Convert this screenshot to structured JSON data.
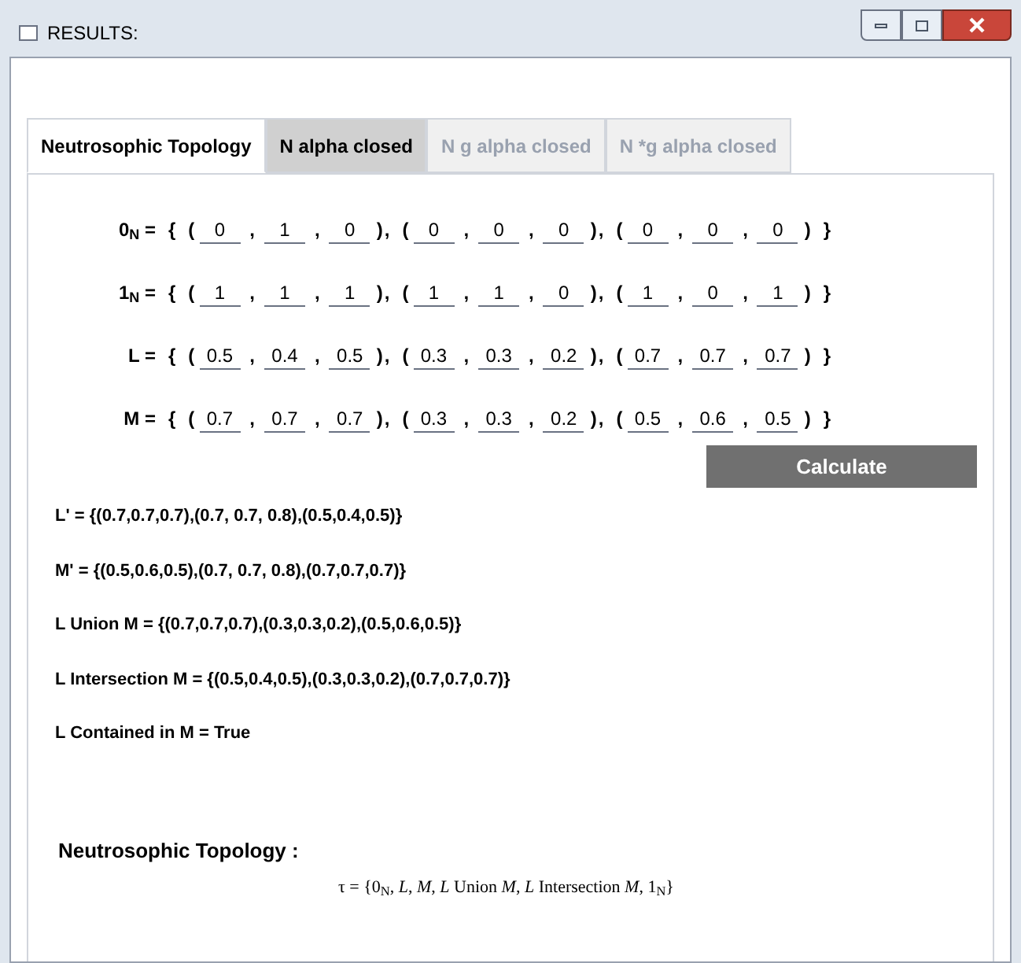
{
  "window": {
    "title": "RESULTS:"
  },
  "tabs": [
    {
      "label": "Neutrosophic Topology",
      "selected": true,
      "hovered": false,
      "disabled": false
    },
    {
      "label": "N alpha closed",
      "selected": false,
      "hovered": true,
      "disabled": false
    },
    {
      "label": "N g alpha closed",
      "selected": false,
      "hovered": false,
      "disabled": true
    },
    {
      "label": "N *g alpha closed",
      "selected": false,
      "hovered": false,
      "disabled": true
    }
  ],
  "sets": [
    {
      "label": "0$_{N}$ =",
      "triples": [
        [
          "0",
          "1",
          "0"
        ],
        [
          "0",
          "0",
          "0"
        ],
        [
          "0",
          "0",
          "0"
        ]
      ]
    },
    {
      "label": "1$_{N}$ =",
      "triples": [
        [
          "1",
          "1",
          "1"
        ],
        [
          "1",
          "1",
          "0"
        ],
        [
          "1",
          "0",
          "1"
        ]
      ]
    },
    {
      "label": "L =",
      "triples": [
        [
          "0.5",
          "0.4",
          "0.5"
        ],
        [
          "0.3",
          "0.3",
          "0.2"
        ],
        [
          "0.7",
          "0.7",
          "0.7"
        ]
      ]
    },
    {
      "label": "M =",
      "triples": [
        [
          "0.7",
          "0.7",
          "0.7"
        ],
        [
          "0.3",
          "0.3",
          "0.2"
        ],
        [
          "0.5",
          "0.6",
          "0.5"
        ]
      ]
    }
  ],
  "punctuation": {
    "open_brace": "{",
    "close_brace": "}",
    "open_paren": "(",
    "close_paren": ")",
    "comma": ","
  },
  "calculate_button": "Calculate",
  "results": [
    "L' = {(0.7,0.7,0.7),(0.7, 0.7, 0.8),(0.5,0.4,0.5)}",
    "M' = {(0.5,0.6,0.5),(0.7, 0.7, 0.8),(0.7,0.7,0.7)}",
    "L Union M = {(0.7,0.7,0.7),(0.3,0.3,0.2),(0.5,0.6,0.5)}",
    "L Intersection M = {(0.5,0.4,0.5),(0.3,0.3,0.2),(0.7,0.7,0.7)}",
    "L Contained in M = True"
  ],
  "topology": {
    "heading": "Neutrosophic Topology :",
    "formula": "τ = {0$_{N}$, *L*, *M*, *L* Union *M*, *L* Intersection *M*, 1$_{N}$}"
  }
}
